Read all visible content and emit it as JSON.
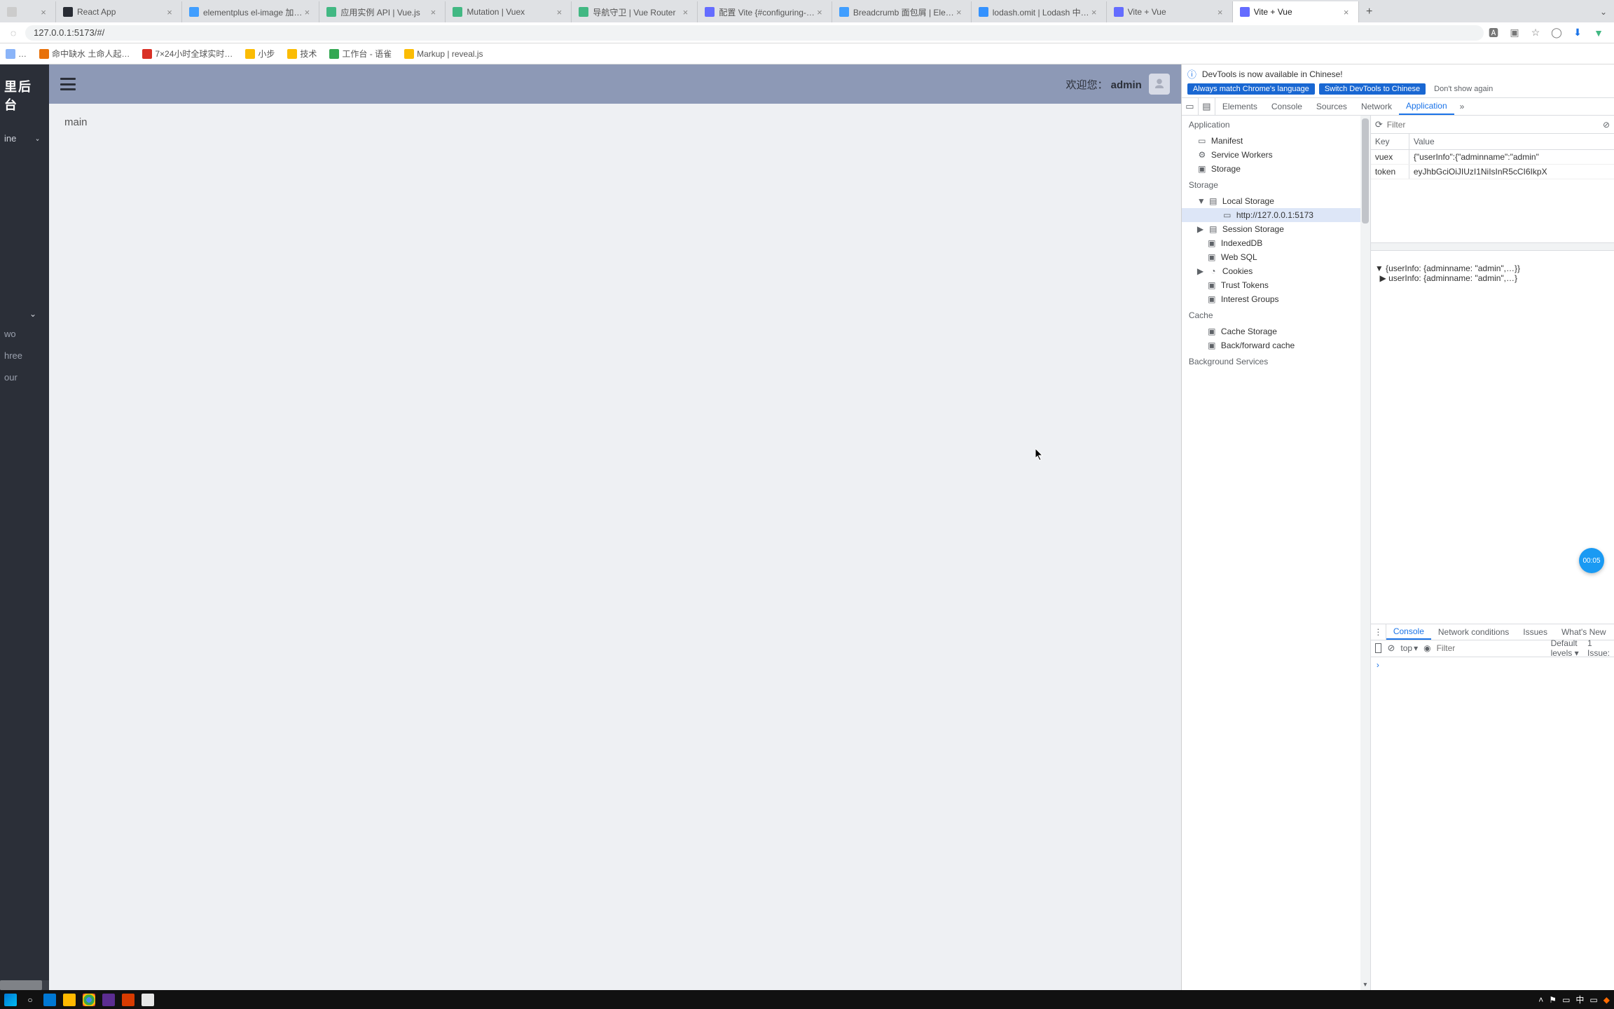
{
  "browser": {
    "url": "127.0.0.1:5173/#/",
    "tabs": [
      {
        "label": "",
        "favicon": "#ccc"
      },
      {
        "label": "React App",
        "favicon": "#282c34"
      },
      {
        "label": "elementplus el-image 加…",
        "favicon": "#409eff"
      },
      {
        "label": "应用实例 API | Vue.js",
        "favicon": "#42b883"
      },
      {
        "label": "Mutation | Vuex",
        "favicon": "#42b883"
      },
      {
        "label": "导航守卫 | Vue Router",
        "favicon": "#42b883"
      },
      {
        "label": "配置 Vite {#configuring-…",
        "favicon": "#646cff"
      },
      {
        "label": "Breadcrumb 面包屑 | Ele…",
        "favicon": "#409eff"
      },
      {
        "label": "lodash.omit | Lodash 中…",
        "favicon": "#3492ff"
      },
      {
        "label": "Vite + Vue",
        "favicon": "#646cff"
      },
      {
        "label": "Vite + Vue",
        "favicon": "#646cff",
        "active": true
      }
    ],
    "bookmarks": [
      {
        "label": "…",
        "color": "#8ab4f8"
      },
      {
        "label": "命中缺水 土命人起…",
        "color": "#e8710a"
      },
      {
        "label": "7×24小时全球实时…",
        "color": "#d93025"
      },
      {
        "label": "小步",
        "color": "#fbbc04"
      },
      {
        "label": "技术",
        "color": "#fbbc04"
      },
      {
        "label": "工作台 - 语雀",
        "color": "#34a853"
      },
      {
        "label": "Markup | reveal.js",
        "color": "#fbbc04"
      }
    ]
  },
  "app": {
    "logo": "里后台",
    "sidebar": {
      "items": [
        {
          "label": "ine",
          "expandable": true,
          "open": true
        },
        {
          "label": "",
          "spacer": true
        },
        {
          "label": "wo"
        },
        {
          "label": "hree"
        },
        {
          "label": "our"
        }
      ]
    },
    "header": {
      "welcome_prefix": "欢迎您：",
      "welcome_user": "admin"
    },
    "content_text": "main"
  },
  "devtools": {
    "banner_text": "DevTools is now available in Chinese!",
    "pill_always": "Always match Chrome's language",
    "pill_switch": "Switch DevTools to Chinese",
    "pill_dismiss": "Don't show again",
    "tabs": [
      "Elements",
      "Console",
      "Sources",
      "Network",
      "Application"
    ],
    "active_tab": "Application",
    "app_panel": {
      "sections": {
        "application": {
          "title": "Application",
          "items": [
            "Manifest",
            "Service Workers",
            "Storage"
          ]
        },
        "storage": {
          "title": "Storage",
          "items": [
            {
              "label": "Local Storage",
              "expandable": true,
              "open": true,
              "children": [
                {
                  "label": "http://127.0.0.1:5173",
                  "selected": true
                }
              ]
            },
            {
              "label": "Session Storage",
              "expandable": true
            },
            {
              "label": "IndexedDB"
            },
            {
              "label": "Web SQL"
            },
            {
              "label": "Cookies",
              "expandable": true
            },
            {
              "label": "Trust Tokens"
            },
            {
              "label": "Interest Groups"
            }
          ]
        },
        "cache": {
          "title": "Cache",
          "items": [
            "Cache Storage",
            "Back/forward cache"
          ]
        },
        "bgsvc": {
          "title": "Background Services"
        }
      }
    },
    "storage_table": {
      "filter_placeholder": "Filter",
      "cols": {
        "key": "Key",
        "value": "Value"
      },
      "rows": [
        {
          "key": "vuex",
          "value": "{\"userInfo\":{\"adminname\":\"admin\""
        },
        {
          "key": "token",
          "value": "eyJhbGciOiJIUzI1NiIsInR5cCI6IkpX"
        }
      ]
    },
    "object_preview": {
      "line1": "▼ {userInfo: {adminname: \"admin\",…}}",
      "line2": "  ▶ userInfo: {adminname: \"admin\",…}"
    },
    "subtabs": [
      "Console",
      "Network conditions",
      "Issues",
      "What's New"
    ],
    "active_subtab": "Console",
    "console_toolbar": {
      "context": "top",
      "filter_placeholder": "Filter",
      "levels": "Default levels ▾",
      "issues": "1 Issue:"
    },
    "console_prompt": "›"
  },
  "badge_timer": "00:05",
  "taskbar": {
    "left_icons": [
      "win",
      "search",
      "vscode",
      "explorer",
      "chrome",
      "vs",
      "ppt",
      "notepad"
    ],
    "tray": [
      "^",
      "vol",
      "net",
      "中",
      "notif",
      "edge"
    ]
  }
}
